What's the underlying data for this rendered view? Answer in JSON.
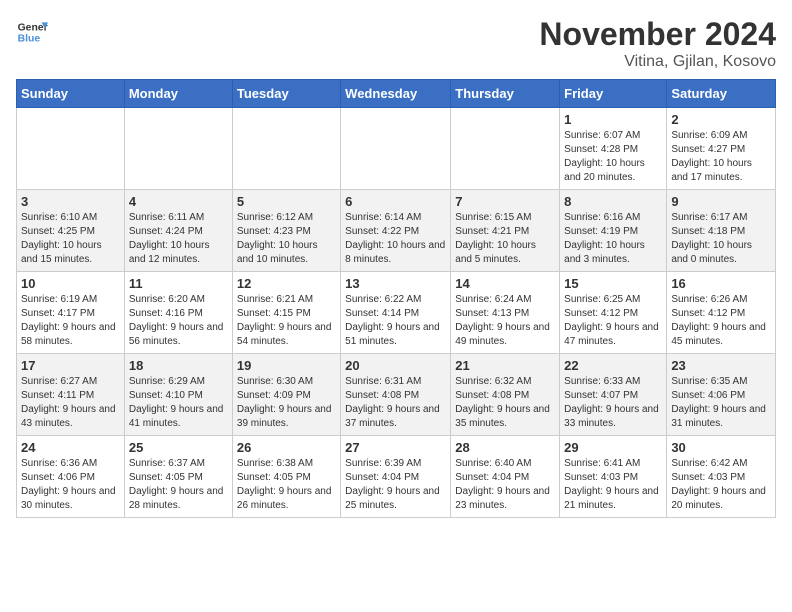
{
  "logo": {
    "line1": "General",
    "line2": "Blue"
  },
  "title": "November 2024",
  "location": "Vitina, Gjilan, Kosovo",
  "weekdays": [
    "Sunday",
    "Monday",
    "Tuesday",
    "Wednesday",
    "Thursday",
    "Friday",
    "Saturday"
  ],
  "weeks": [
    [
      {
        "day": "",
        "info": ""
      },
      {
        "day": "",
        "info": ""
      },
      {
        "day": "",
        "info": ""
      },
      {
        "day": "",
        "info": ""
      },
      {
        "day": "",
        "info": ""
      },
      {
        "day": "1",
        "info": "Sunrise: 6:07 AM\nSunset: 4:28 PM\nDaylight: 10 hours and 20 minutes."
      },
      {
        "day": "2",
        "info": "Sunrise: 6:09 AM\nSunset: 4:27 PM\nDaylight: 10 hours and 17 minutes."
      }
    ],
    [
      {
        "day": "3",
        "info": "Sunrise: 6:10 AM\nSunset: 4:25 PM\nDaylight: 10 hours and 15 minutes."
      },
      {
        "day": "4",
        "info": "Sunrise: 6:11 AM\nSunset: 4:24 PM\nDaylight: 10 hours and 12 minutes."
      },
      {
        "day": "5",
        "info": "Sunrise: 6:12 AM\nSunset: 4:23 PM\nDaylight: 10 hours and 10 minutes."
      },
      {
        "day": "6",
        "info": "Sunrise: 6:14 AM\nSunset: 4:22 PM\nDaylight: 10 hours and 8 minutes."
      },
      {
        "day": "7",
        "info": "Sunrise: 6:15 AM\nSunset: 4:21 PM\nDaylight: 10 hours and 5 minutes."
      },
      {
        "day": "8",
        "info": "Sunrise: 6:16 AM\nSunset: 4:19 PM\nDaylight: 10 hours and 3 minutes."
      },
      {
        "day": "9",
        "info": "Sunrise: 6:17 AM\nSunset: 4:18 PM\nDaylight: 10 hours and 0 minutes."
      }
    ],
    [
      {
        "day": "10",
        "info": "Sunrise: 6:19 AM\nSunset: 4:17 PM\nDaylight: 9 hours and 58 minutes."
      },
      {
        "day": "11",
        "info": "Sunrise: 6:20 AM\nSunset: 4:16 PM\nDaylight: 9 hours and 56 minutes."
      },
      {
        "day": "12",
        "info": "Sunrise: 6:21 AM\nSunset: 4:15 PM\nDaylight: 9 hours and 54 minutes."
      },
      {
        "day": "13",
        "info": "Sunrise: 6:22 AM\nSunset: 4:14 PM\nDaylight: 9 hours and 51 minutes."
      },
      {
        "day": "14",
        "info": "Sunrise: 6:24 AM\nSunset: 4:13 PM\nDaylight: 9 hours and 49 minutes."
      },
      {
        "day": "15",
        "info": "Sunrise: 6:25 AM\nSunset: 4:12 PM\nDaylight: 9 hours and 47 minutes."
      },
      {
        "day": "16",
        "info": "Sunrise: 6:26 AM\nSunset: 4:12 PM\nDaylight: 9 hours and 45 minutes."
      }
    ],
    [
      {
        "day": "17",
        "info": "Sunrise: 6:27 AM\nSunset: 4:11 PM\nDaylight: 9 hours and 43 minutes."
      },
      {
        "day": "18",
        "info": "Sunrise: 6:29 AM\nSunset: 4:10 PM\nDaylight: 9 hours and 41 minutes."
      },
      {
        "day": "19",
        "info": "Sunrise: 6:30 AM\nSunset: 4:09 PM\nDaylight: 9 hours and 39 minutes."
      },
      {
        "day": "20",
        "info": "Sunrise: 6:31 AM\nSunset: 4:08 PM\nDaylight: 9 hours and 37 minutes."
      },
      {
        "day": "21",
        "info": "Sunrise: 6:32 AM\nSunset: 4:08 PM\nDaylight: 9 hours and 35 minutes."
      },
      {
        "day": "22",
        "info": "Sunrise: 6:33 AM\nSunset: 4:07 PM\nDaylight: 9 hours and 33 minutes."
      },
      {
        "day": "23",
        "info": "Sunrise: 6:35 AM\nSunset: 4:06 PM\nDaylight: 9 hours and 31 minutes."
      }
    ],
    [
      {
        "day": "24",
        "info": "Sunrise: 6:36 AM\nSunset: 4:06 PM\nDaylight: 9 hours and 30 minutes."
      },
      {
        "day": "25",
        "info": "Sunrise: 6:37 AM\nSunset: 4:05 PM\nDaylight: 9 hours and 28 minutes."
      },
      {
        "day": "26",
        "info": "Sunrise: 6:38 AM\nSunset: 4:05 PM\nDaylight: 9 hours and 26 minutes."
      },
      {
        "day": "27",
        "info": "Sunrise: 6:39 AM\nSunset: 4:04 PM\nDaylight: 9 hours and 25 minutes."
      },
      {
        "day": "28",
        "info": "Sunrise: 6:40 AM\nSunset: 4:04 PM\nDaylight: 9 hours and 23 minutes."
      },
      {
        "day": "29",
        "info": "Sunrise: 6:41 AM\nSunset: 4:03 PM\nDaylight: 9 hours and 21 minutes."
      },
      {
        "day": "30",
        "info": "Sunrise: 6:42 AM\nSunset: 4:03 PM\nDaylight: 9 hours and 20 minutes."
      }
    ]
  ]
}
